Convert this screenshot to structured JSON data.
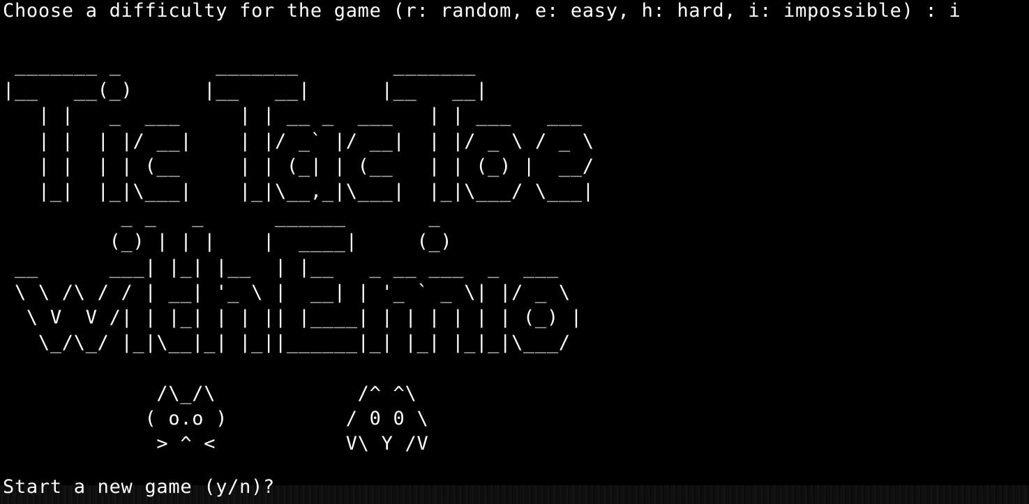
{
  "terminal": {
    "background": "#000000",
    "foreground": "#ffffff",
    "difficulty_prompt": "Choose a difficulty for the game (r: random, e: easy, h: hard, i: impossible) : i",
    "banner_art": " _______ _        _______        _______\n|__   __(_)      |__   __|      |__   __|\n   | |   _  ___     | | __ _  ___   | | ___   ___\n   | |  | |/ __|    | |/ _` |/ __|  | |/ _ \\ / _ \\\n   | |  | | (__     | | (_| | (__   | | (_) |  __/\n   |_|  |_|\\___|    |_|\\__,_|\\___|  |_|\\___/ \\___|\n          _ _   _      ______       _\n         (_) | | |    |  ____|     (_)\n __      ___| |_| |__  | |__   _ __ ___  _  ___\n \\ \\ /\\ / / | __| '_ \\ |  __| | '_ ` _ \\| |/ _ \\\n  \\ V  V /| | |_| | | || |____| | | | | | | (_) |\n   \\_/\\_/ |_|\\__|_| |_||______|_| |_| |_|_|\\___/\n\n             /\\_/\\            /^ ^\\\n            ( o.o )          / 0 0 \\\n             > ^ <           V\\ Y /V",
    "new_game_prompt": "Start a new game (y/n)?"
  }
}
